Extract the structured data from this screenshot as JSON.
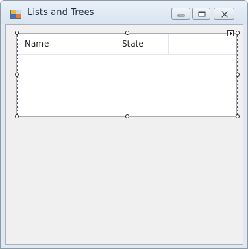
{
  "window": {
    "title": "Lists and Trees"
  },
  "listview": {
    "columns": [
      "Name",
      "State"
    ]
  },
  "colors": {
    "titlebar": "#dfe8f3",
    "client_bg": "#f0f0f0",
    "list_bg": "#ffffff"
  },
  "icons": {
    "app": "form-icon",
    "minimize": "minimize-icon",
    "maximize": "maximize-icon",
    "close": "close-icon",
    "smart_tag": "smart-tag-arrow-icon"
  }
}
